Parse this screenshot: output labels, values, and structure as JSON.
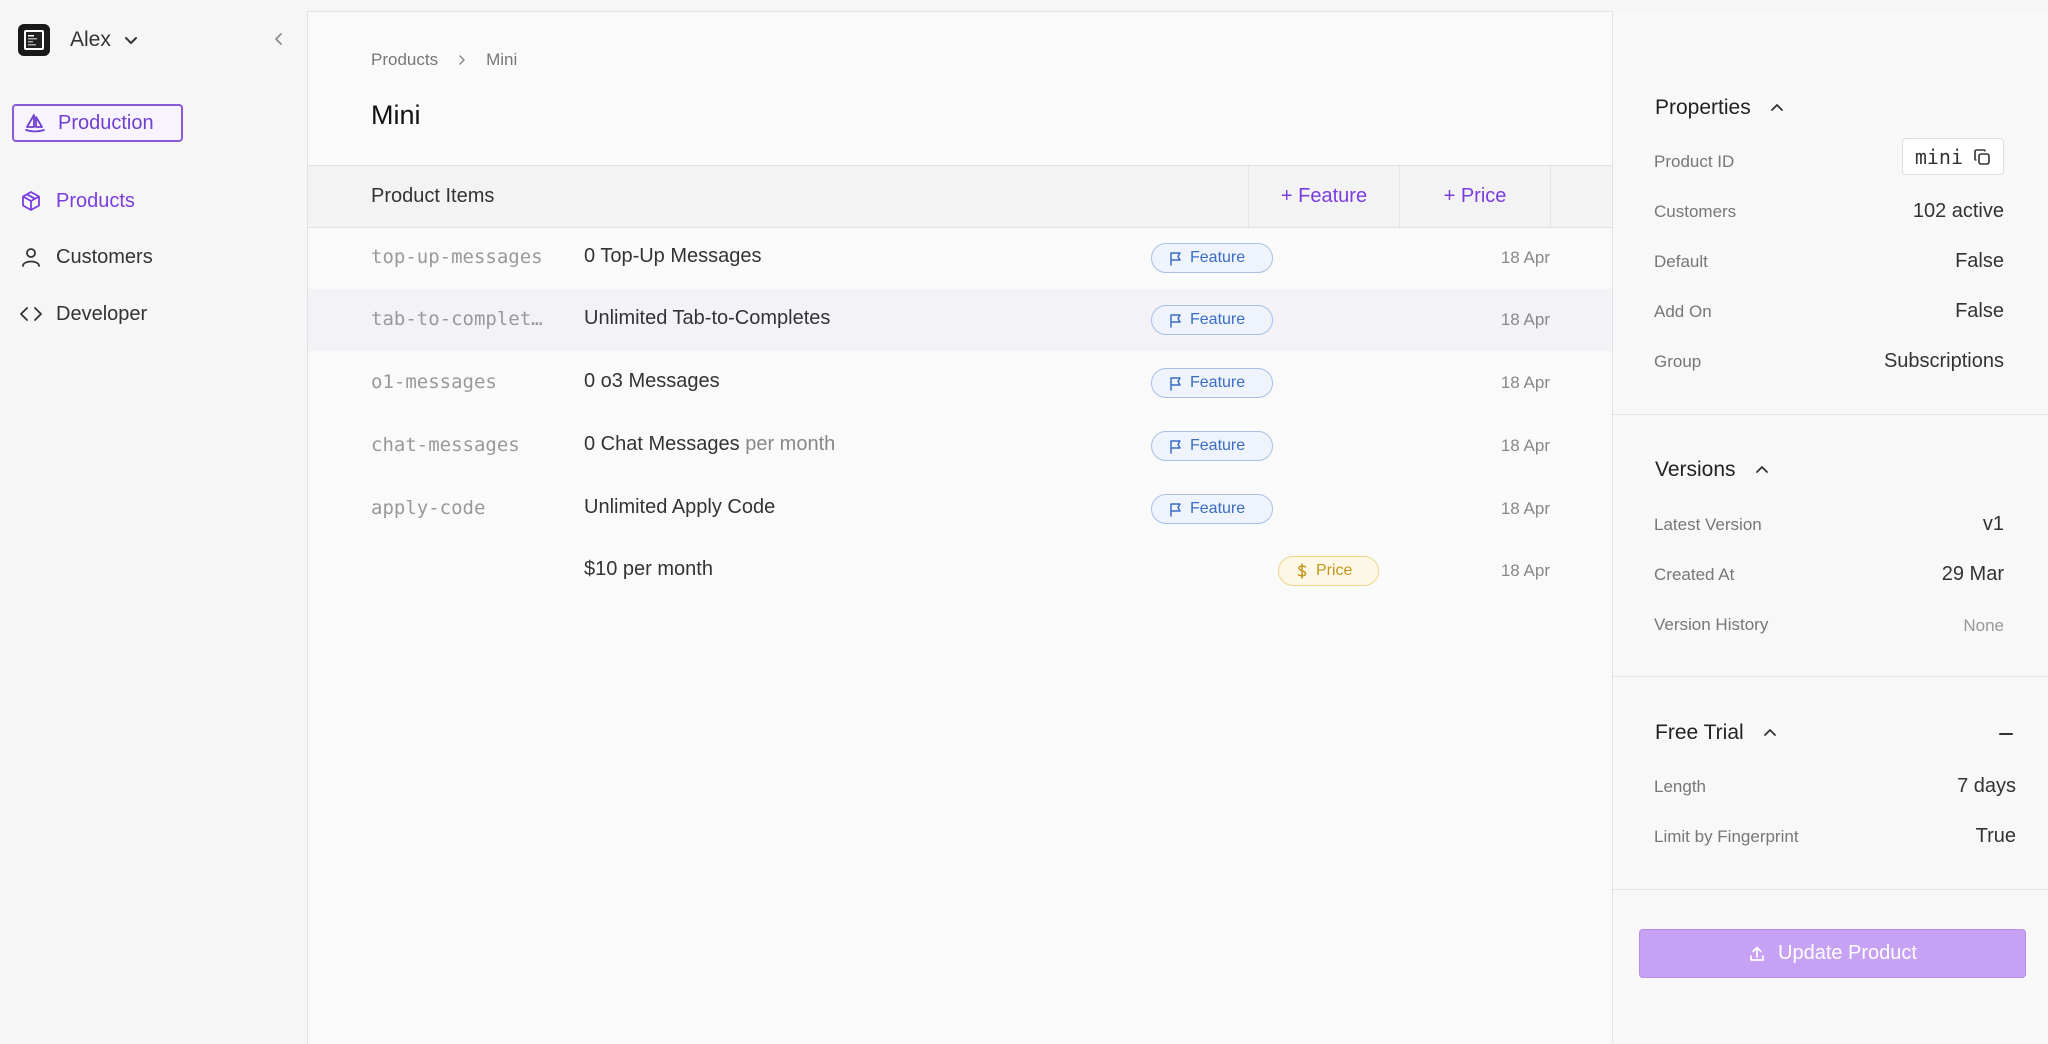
{
  "workspace": {
    "name": "Alex"
  },
  "environment": {
    "label": "Production"
  },
  "nav": [
    {
      "label": "Products",
      "active": true
    },
    {
      "label": "Customers",
      "active": false
    },
    {
      "label": "Developer",
      "active": false
    }
  ],
  "breadcrumb": [
    "Products",
    "Mini"
  ],
  "page": {
    "title": "Mini"
  },
  "items": {
    "header": "Product Items",
    "add_feature": "+ Feature",
    "add_price": "+ Price",
    "rows": [
      {
        "id": "top-up-messages",
        "desc": "0 Top-Up Messages",
        "suffix": "",
        "tag": "Feature",
        "date": "18 Apr"
      },
      {
        "id": "tab-to-complet…",
        "desc": "Unlimited Tab-to-Completes",
        "suffix": "",
        "tag": "Feature",
        "date": "18 Apr"
      },
      {
        "id": "o1-messages",
        "desc": "0 o3 Messages",
        "suffix": "",
        "tag": "Feature",
        "date": "18 Apr"
      },
      {
        "id": "chat-messages",
        "desc": "0 Chat Messages",
        "suffix": " per month",
        "tag": "Feature",
        "date": "18 Apr"
      },
      {
        "id": "apply-code",
        "desc": "Unlimited Apply Code",
        "suffix": "",
        "tag": "Feature",
        "date": "18 Apr"
      },
      {
        "id": "",
        "desc": "$10 per month",
        "suffix": "",
        "tag": "Price",
        "date": "18 Apr"
      }
    ]
  },
  "properties": {
    "title": "Properties",
    "product_id_label": "Product ID",
    "product_id": "mini",
    "customers_label": "Customers",
    "customers": "102 active",
    "default_label": "Default",
    "default": "False",
    "addon_label": "Add On",
    "addon": "False",
    "group_label": "Group",
    "group": "Subscriptions"
  },
  "versions": {
    "title": "Versions",
    "latest_label": "Latest Version",
    "latest": "v1",
    "created_label": "Created At",
    "created": "29 Mar",
    "history_label": "Version History",
    "history": "None"
  },
  "free_trial": {
    "title": "Free Trial",
    "length_label": "Length",
    "length": "7 days",
    "fingerprint_label": "Limit by Fingerprint",
    "fingerprint": "True"
  },
  "update_button": "Update Product",
  "colors": {
    "accent": "#7a3ee0",
    "feature_tag": "#3a6dc4",
    "price_tag": "#c5951c",
    "update_button": "#c7a2f4"
  }
}
